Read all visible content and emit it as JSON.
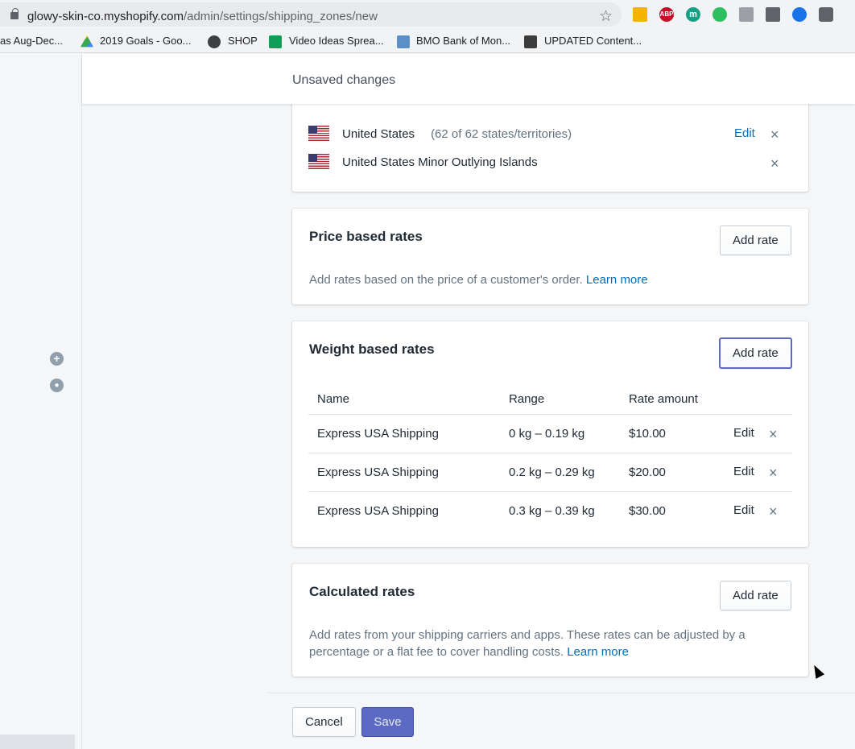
{
  "browser": {
    "url_host": "glowy-skin-co.myshopify.com",
    "url_path": "/admin/settings/shipping_zones/new",
    "extensions": [
      {
        "name": "google-drive-icon",
        "label": "",
        "color": "#f4b400"
      },
      {
        "name": "adblock-icon",
        "label": "ABP",
        "color": "#c70d2c"
      },
      {
        "name": "m-extension-icon",
        "label": "m",
        "color": "#16a085"
      },
      {
        "name": "evernote-icon",
        "label": "",
        "color": "#2dbe60"
      },
      {
        "name": "screenshot-icon",
        "label": "",
        "color": "#9aa0a6"
      },
      {
        "name": "eyedropper-icon",
        "label": "",
        "color": "#5f6368"
      },
      {
        "name": "share-icon",
        "label": "",
        "color": "#1a73e8"
      },
      {
        "name": "window-icon",
        "label": "",
        "color": "#5f6368"
      }
    ],
    "bookmarks": [
      {
        "label": "as Aug-Dec..."
      },
      {
        "label": "2019 Goals - Goo..."
      },
      {
        "label": "SHOP"
      },
      {
        "label": "Video Ideas Sprea..."
      },
      {
        "label": "BMO Bank of Mon..."
      },
      {
        "label": "UPDATED Content..."
      }
    ]
  },
  "topbar": {
    "title": "Unsaved changes"
  },
  "countries": [
    {
      "name": "United States",
      "detail": "(62 of 62 states/territories)",
      "edit": "Edit"
    },
    {
      "name": "United States Minor Outlying Islands",
      "detail": "",
      "edit": ""
    }
  ],
  "price_rates": {
    "title": "Price based rates",
    "add_label": "Add rate",
    "description": "Add rates based on the price of a customer's order.",
    "learn_more": "Learn more"
  },
  "weight_rates": {
    "title": "Weight based rates",
    "add_label": "Add rate",
    "headers": {
      "name": "Name",
      "range": "Range",
      "amount": "Rate amount"
    },
    "rows": [
      {
        "name": "Express USA Shipping",
        "range": "0 kg – 0.19 kg",
        "amount": "$10.00",
        "edit": "Edit"
      },
      {
        "name": "Express USA Shipping",
        "range": "0.2 kg – 0.29 kg",
        "amount": "$20.00",
        "edit": "Edit"
      },
      {
        "name": "Express USA Shipping",
        "range": "0.3 kg – 0.39 kg",
        "amount": "$30.00",
        "edit": "Edit"
      }
    ]
  },
  "calculated_rates": {
    "title": "Calculated rates",
    "add_label": "Add rate",
    "description_line1": "Add rates from your shipping carriers and apps. These rates can be adjusted by a",
    "description_line2": "percentage or a flat fee to cover handling costs.",
    "learn_more": "Learn more"
  },
  "footer": {
    "cancel_label": "Cancel",
    "save_label": "Save"
  },
  "colors": {
    "primary": "#5c6ac4",
    "link": "#006fbb",
    "text": "#212b36",
    "muted": "#637381"
  }
}
